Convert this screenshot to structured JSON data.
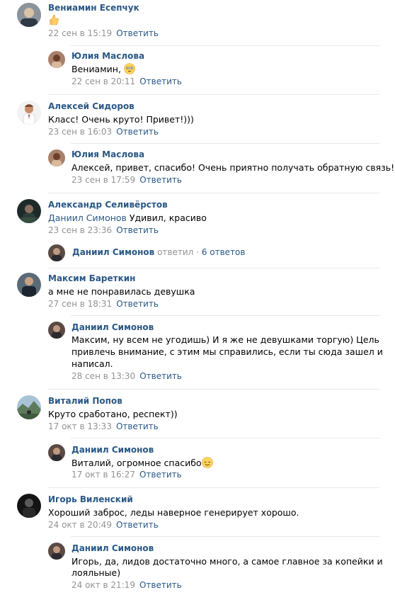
{
  "comments": [
    {
      "author": "Вениамин Есепчук",
      "text": "",
      "emoji": "thumbs-up",
      "date": "22 сен в 15:19",
      "reply_label": "Ответить",
      "replies": [
        {
          "author": "Юлия Маслова",
          "text": "Вениамин,",
          "emoji": "flushed",
          "date": "22 сен в 20:11",
          "reply_label": "Ответить"
        }
      ]
    },
    {
      "author": "Алексей Сидоров",
      "text": "Класс! Очень круто! Привет!)))",
      "date": "23 сен в 16:03",
      "reply_label": "Ответить",
      "replies": [
        {
          "author": "Юлия Маслова",
          "text": "Алексей, привет, спасибо! Очень приятно получать обратную связь!",
          "date": "23 сен в 17:59",
          "reply_label": "Ответить"
        }
      ]
    },
    {
      "author": "Александр Селивёрстов",
      "mention": "Даниил Симонов",
      "text": "Удивил, красиво",
      "date": "23 сен в 23:36",
      "reply_label": "Ответить",
      "thread": {
        "who": "Даниил Симонов",
        "verb": "ответил",
        "sep": "·",
        "count": "6 ответов"
      }
    },
    {
      "author": "Максим Бареткин",
      "text": "а мне не понравилась девушка",
      "date": "27 сен в 18:31",
      "reply_label": "Ответить",
      "replies": [
        {
          "author": "Даниил Симонов",
          "text_lines": [
            "Максим, ну всем не угодишь) И я же не девушками торгую) Цель",
            "привлечь внимание, с этим мы справились, если ты сюда зашел и",
            "написал."
          ],
          "date": "28 сен в 13:30",
          "reply_label": "Ответить"
        }
      ]
    },
    {
      "author": "Виталий Попов",
      "text": "Круто сработано, респект))",
      "date": "17 окт в 13:33",
      "reply_label": "Ответить",
      "replies": [
        {
          "author": "Даниил Симонов",
          "text": "Виталий, огромное спасибо",
          "emoji": "relieved",
          "date": "17 окт в 16:27",
          "reply_label": "Ответить"
        }
      ]
    },
    {
      "author": "Игорь Виленский",
      "text": "Хороший заброс, леды наверное генерирует хорошо.",
      "date": "24 окт в 20:49",
      "reply_label": "Ответить",
      "replies": [
        {
          "author": "Даниил Симонов",
          "text_lines": [
            "Игорь, да, лидов достаточно много, а самое главное за копейки и",
            "лояльные)"
          ],
          "date": "24 окт в 21:19",
          "reply_label": "Ответить"
        }
      ]
    }
  ]
}
